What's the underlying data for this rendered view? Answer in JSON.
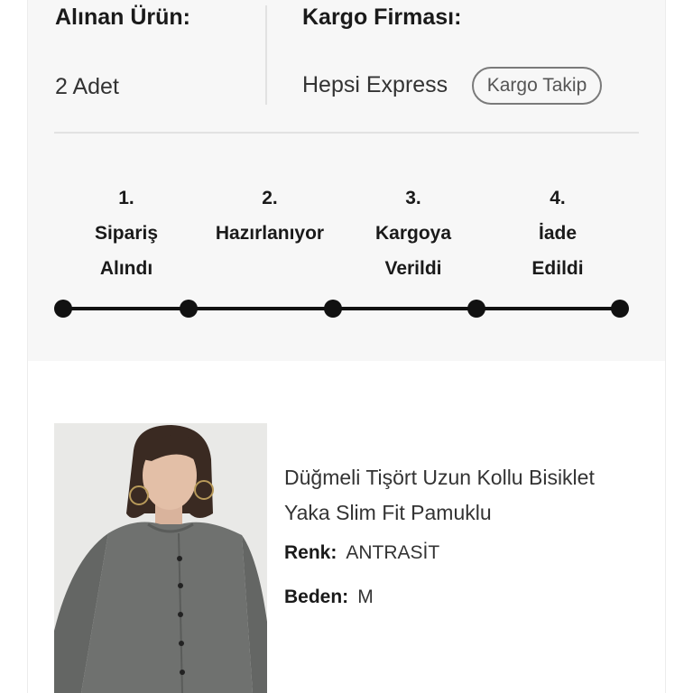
{
  "summary": {
    "received_title": "Alınan Ürün:",
    "received_value": "2 Adet",
    "cargo_title": "Kargo Firması:",
    "cargo_value": "Hepsi Express",
    "track_button": "Kargo Takip"
  },
  "steps": [
    {
      "number": "1.",
      "line1": "Sipariş",
      "line2": "Alındı"
    },
    {
      "number": "2.",
      "line1": "Hazırlanıyor",
      "line2": ""
    },
    {
      "number": "3.",
      "line1": "Kargoya",
      "line2": "Verildi"
    },
    {
      "number": "4.",
      "line1": "İade",
      "line2": "Edildi"
    }
  ],
  "progress": {
    "completed_steps": 4,
    "total_steps": 4
  },
  "product": {
    "name_line1": "Düğmeli Tişört Uzun Kollu Bisiklet",
    "name_line2": "Yaka Slim Fit Pamuklu",
    "color_label": "Renk:",
    "color_value": "ANTRASİT",
    "size_label": "Beden:",
    "size_value": "M"
  },
  "colors": {
    "background": "#f7f7f7",
    "accent": "#111111",
    "divider": "#e2e2e2",
    "garment": "#6f716f"
  }
}
